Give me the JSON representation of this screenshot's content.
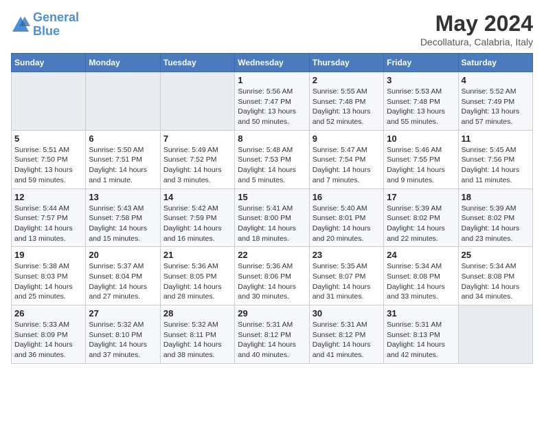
{
  "logo": {
    "line1": "General",
    "line2": "Blue"
  },
  "title": "May 2024",
  "location": "Decollatura, Calabria, Italy",
  "headers": [
    "Sunday",
    "Monday",
    "Tuesday",
    "Wednesday",
    "Thursday",
    "Friday",
    "Saturday"
  ],
  "weeks": [
    [
      {
        "num": "",
        "detail": ""
      },
      {
        "num": "",
        "detail": ""
      },
      {
        "num": "",
        "detail": ""
      },
      {
        "num": "1",
        "detail": "Sunrise: 5:56 AM\nSunset: 7:47 PM\nDaylight: 13 hours\nand 50 minutes."
      },
      {
        "num": "2",
        "detail": "Sunrise: 5:55 AM\nSunset: 7:48 PM\nDaylight: 13 hours\nand 52 minutes."
      },
      {
        "num": "3",
        "detail": "Sunrise: 5:53 AM\nSunset: 7:48 PM\nDaylight: 13 hours\nand 55 minutes."
      },
      {
        "num": "4",
        "detail": "Sunrise: 5:52 AM\nSunset: 7:49 PM\nDaylight: 13 hours\nand 57 minutes."
      }
    ],
    [
      {
        "num": "5",
        "detail": "Sunrise: 5:51 AM\nSunset: 7:50 PM\nDaylight: 13 hours\nand 59 minutes."
      },
      {
        "num": "6",
        "detail": "Sunrise: 5:50 AM\nSunset: 7:51 PM\nDaylight: 14 hours\nand 1 minute."
      },
      {
        "num": "7",
        "detail": "Sunrise: 5:49 AM\nSunset: 7:52 PM\nDaylight: 14 hours\nand 3 minutes."
      },
      {
        "num": "8",
        "detail": "Sunrise: 5:48 AM\nSunset: 7:53 PM\nDaylight: 14 hours\nand 5 minutes."
      },
      {
        "num": "9",
        "detail": "Sunrise: 5:47 AM\nSunset: 7:54 PM\nDaylight: 14 hours\nand 7 minutes."
      },
      {
        "num": "10",
        "detail": "Sunrise: 5:46 AM\nSunset: 7:55 PM\nDaylight: 14 hours\nand 9 minutes."
      },
      {
        "num": "11",
        "detail": "Sunrise: 5:45 AM\nSunset: 7:56 PM\nDaylight: 14 hours\nand 11 minutes."
      }
    ],
    [
      {
        "num": "12",
        "detail": "Sunrise: 5:44 AM\nSunset: 7:57 PM\nDaylight: 14 hours\nand 13 minutes."
      },
      {
        "num": "13",
        "detail": "Sunrise: 5:43 AM\nSunset: 7:58 PM\nDaylight: 14 hours\nand 15 minutes."
      },
      {
        "num": "14",
        "detail": "Sunrise: 5:42 AM\nSunset: 7:59 PM\nDaylight: 14 hours\nand 16 minutes."
      },
      {
        "num": "15",
        "detail": "Sunrise: 5:41 AM\nSunset: 8:00 PM\nDaylight: 14 hours\nand 18 minutes."
      },
      {
        "num": "16",
        "detail": "Sunrise: 5:40 AM\nSunset: 8:01 PM\nDaylight: 14 hours\nand 20 minutes."
      },
      {
        "num": "17",
        "detail": "Sunrise: 5:39 AM\nSunset: 8:02 PM\nDaylight: 14 hours\nand 22 minutes."
      },
      {
        "num": "18",
        "detail": "Sunrise: 5:39 AM\nSunset: 8:02 PM\nDaylight: 14 hours\nand 23 minutes."
      }
    ],
    [
      {
        "num": "19",
        "detail": "Sunrise: 5:38 AM\nSunset: 8:03 PM\nDaylight: 14 hours\nand 25 minutes."
      },
      {
        "num": "20",
        "detail": "Sunrise: 5:37 AM\nSunset: 8:04 PM\nDaylight: 14 hours\nand 27 minutes."
      },
      {
        "num": "21",
        "detail": "Sunrise: 5:36 AM\nSunset: 8:05 PM\nDaylight: 14 hours\nand 28 minutes."
      },
      {
        "num": "22",
        "detail": "Sunrise: 5:36 AM\nSunset: 8:06 PM\nDaylight: 14 hours\nand 30 minutes."
      },
      {
        "num": "23",
        "detail": "Sunrise: 5:35 AM\nSunset: 8:07 PM\nDaylight: 14 hours\nand 31 minutes."
      },
      {
        "num": "24",
        "detail": "Sunrise: 5:34 AM\nSunset: 8:08 PM\nDaylight: 14 hours\nand 33 minutes."
      },
      {
        "num": "25",
        "detail": "Sunrise: 5:34 AM\nSunset: 8:08 PM\nDaylight: 14 hours\nand 34 minutes."
      }
    ],
    [
      {
        "num": "26",
        "detail": "Sunrise: 5:33 AM\nSunset: 8:09 PM\nDaylight: 14 hours\nand 36 minutes."
      },
      {
        "num": "27",
        "detail": "Sunrise: 5:32 AM\nSunset: 8:10 PM\nDaylight: 14 hours\nand 37 minutes."
      },
      {
        "num": "28",
        "detail": "Sunrise: 5:32 AM\nSunset: 8:11 PM\nDaylight: 14 hours\nand 38 minutes."
      },
      {
        "num": "29",
        "detail": "Sunrise: 5:31 AM\nSunset: 8:12 PM\nDaylight: 14 hours\nand 40 minutes."
      },
      {
        "num": "30",
        "detail": "Sunrise: 5:31 AM\nSunset: 8:12 PM\nDaylight: 14 hours\nand 41 minutes."
      },
      {
        "num": "31",
        "detail": "Sunrise: 5:31 AM\nSunset: 8:13 PM\nDaylight: 14 hours\nand 42 minutes."
      },
      {
        "num": "",
        "detail": ""
      }
    ]
  ]
}
